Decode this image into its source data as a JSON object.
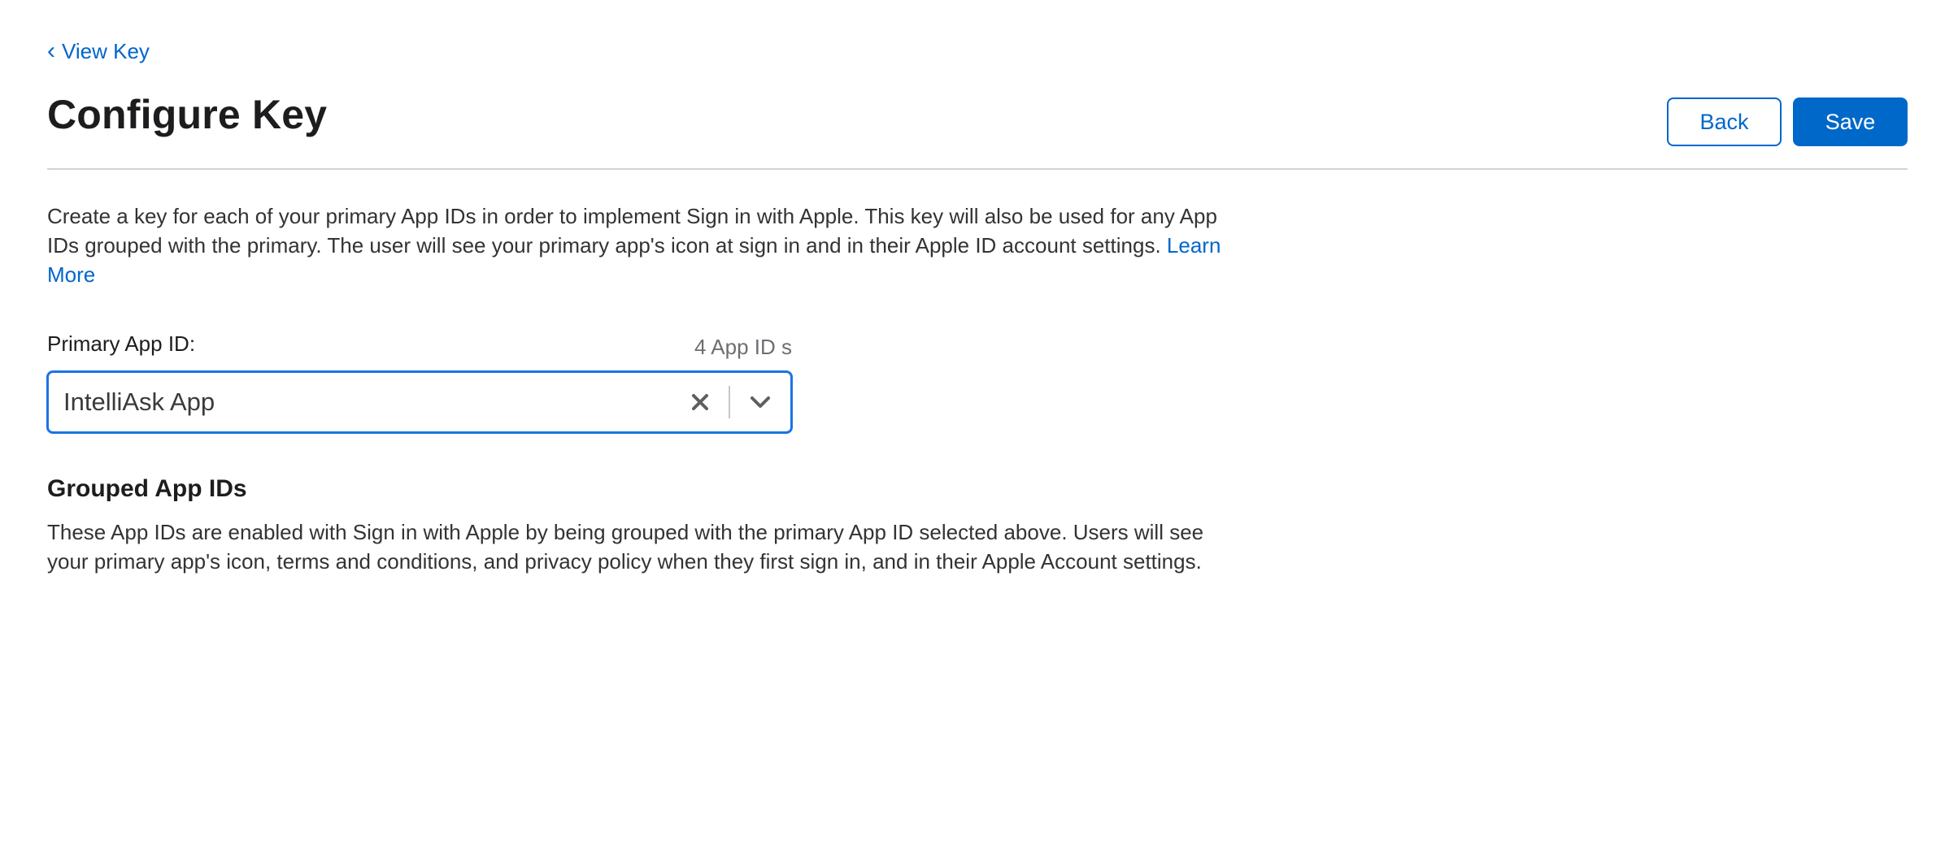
{
  "breadcrumb": {
    "label": "View Key"
  },
  "header": {
    "title": "Configure Key",
    "back_label": "Back",
    "save_label": "Save"
  },
  "intro": {
    "text": "Create a key for each of your primary App IDs in order to implement Sign in with Apple. This key will also be used for any App IDs grouped with the primary. The user will see your primary app's icon at sign in and in their Apple ID account settings.",
    "link_label": "Learn More"
  },
  "primary_app_id": {
    "label": "Primary App ID:",
    "count": "4 App ID s",
    "selected_value": "IntelliAsk App"
  },
  "grouped": {
    "title": "Grouped App IDs",
    "description": "These App IDs are enabled with Sign in with Apple by being grouped with the primary App ID selected above. Users will see your primary app's icon, terms and conditions, and privacy policy when they first sign in, and in their Apple Account settings."
  },
  "icons": {
    "breadcrumb": "chevron-left-icon",
    "clear": "close-icon",
    "dropdown": "chevron-down-icon"
  },
  "colors": {
    "accent": "#0066cc",
    "focus_border": "#1b74e4",
    "text": "#1d1d1f"
  }
}
